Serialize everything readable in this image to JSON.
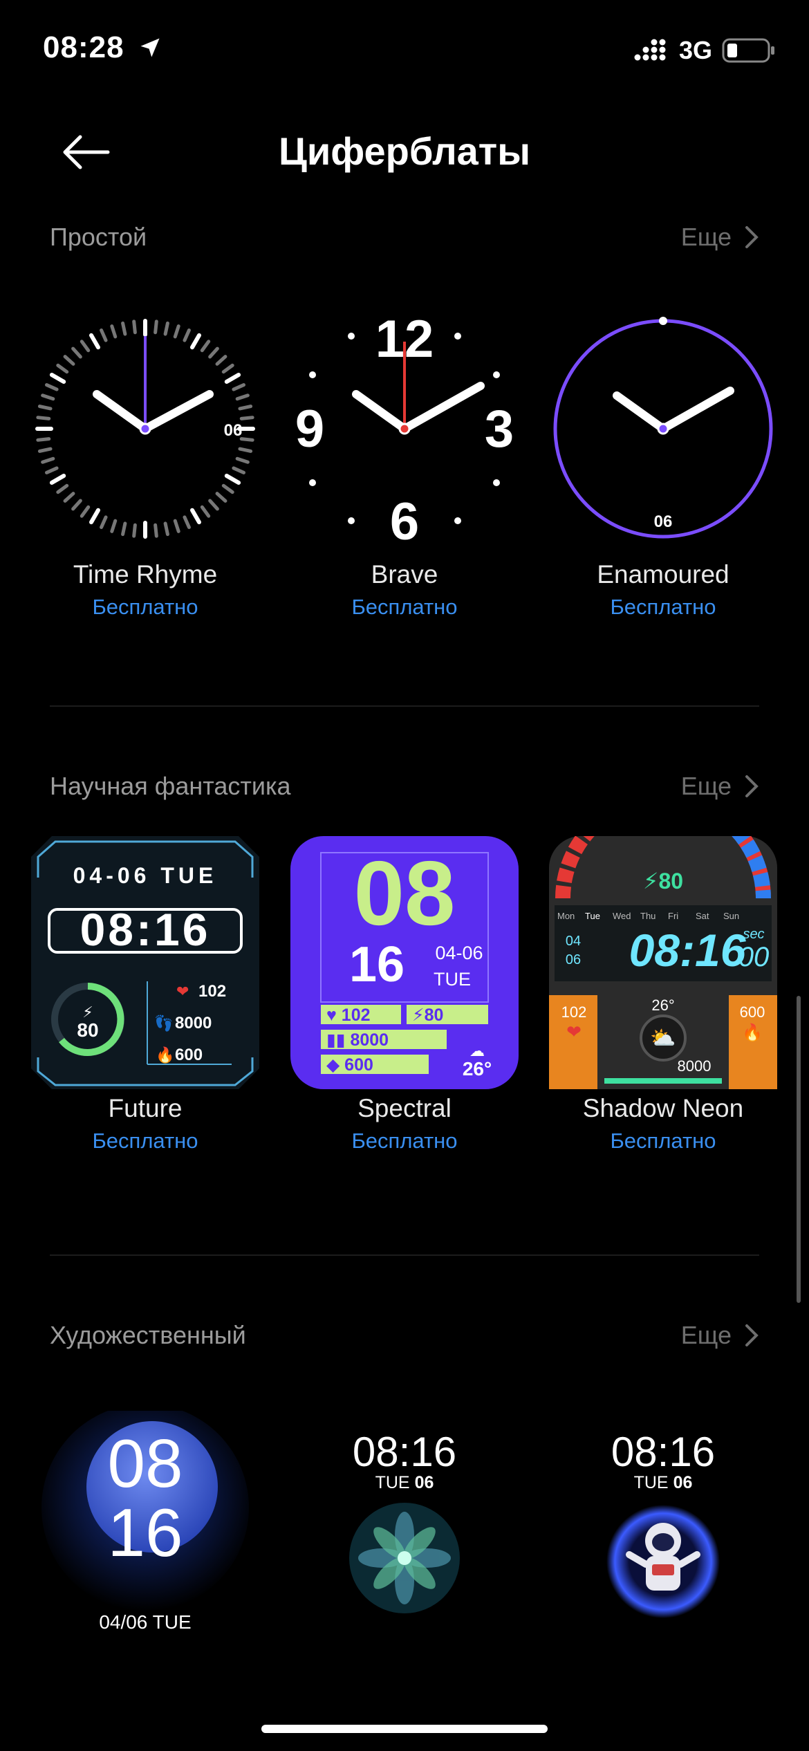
{
  "status": {
    "time": "08:28",
    "network": "3G"
  },
  "header": {
    "title": "Циферблаты"
  },
  "sections": [
    {
      "title": "Простой",
      "more": "Еще",
      "items": [
        {
          "name": "Time Rhyme",
          "price": "Бесплатно",
          "day": "06"
        },
        {
          "name": "Brave",
          "price": "Бесплатно",
          "numerals": [
            "12",
            "3",
            "6",
            "9"
          ]
        },
        {
          "name": "Enamoured",
          "price": "Бесплатно",
          "day": "06"
        }
      ]
    },
    {
      "title": "Научная фантастика",
      "more": "Еще",
      "items": [
        {
          "name": "Future",
          "price": "Бесплатно",
          "date": "04-06",
          "weekday": "TUE",
          "time": "08:16",
          "energy": "80",
          "heart": "102",
          "steps": "8000",
          "calories": "600"
        },
        {
          "name": "Spectral",
          "price": "Бесплатно",
          "hour": "08",
          "minute": "16",
          "date": "04-06",
          "weekday": "TUE",
          "heart": "102",
          "energy": "80",
          "steps": "8000",
          "calories": "600",
          "temp": "26°"
        },
        {
          "name": "Shadow Neon",
          "price": "Бесплатно",
          "energy": "80",
          "days": [
            "Mon",
            "Tue",
            "Wed",
            "Thu",
            "Fri",
            "Sat",
            "Sun"
          ],
          "month": "04",
          "day": "06",
          "time": "08:16",
          "sec_label": "sec",
          "sec": "00",
          "heart": "102",
          "temp": "26°",
          "calories": "600",
          "steps": "8000"
        }
      ]
    },
    {
      "title": "Художественный",
      "more": "Еще",
      "items": [
        {
          "hour": "08",
          "minute": "16",
          "date": "04/06",
          "weekday": "TUE"
        },
        {
          "time": "08:16",
          "weekday": "TUE",
          "day": "06"
        },
        {
          "time": "08:16",
          "weekday": "TUE",
          "day": "06"
        }
      ]
    }
  ],
  "colors": {
    "accent": "#3a8ff0",
    "purple": "#7b4dff",
    "spectral_bg": "#5a2df0",
    "spectral_fg": "#c8ee8a",
    "red_hand": "#e53935"
  }
}
